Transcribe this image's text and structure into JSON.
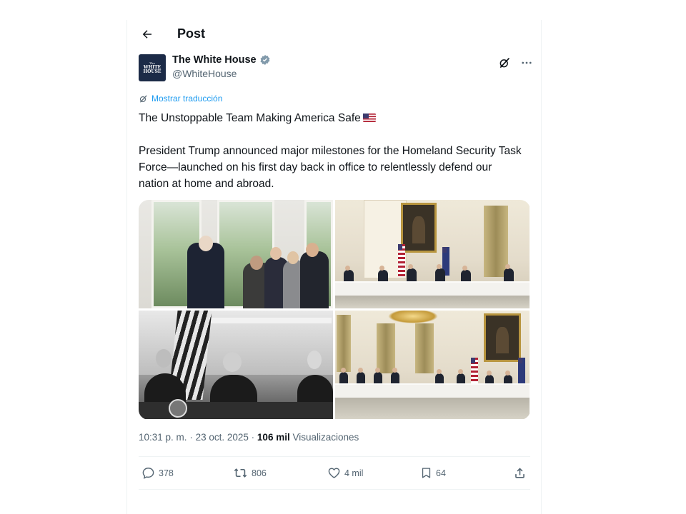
{
  "header": {
    "title": "Post"
  },
  "author": {
    "display_name": "The White House",
    "handle": "@WhiteHouse",
    "avatar_lines": [
      "The",
      "WHITE",
      "HOUSE"
    ],
    "verified_color": "#829aab"
  },
  "translate_label": "Mostrar traducción",
  "post": {
    "line1": "The Unstoppable Team Making America Safe",
    "body": "President Trump announced major milestones for the Homeland Security Task Force—launched on his first day back in office to relentlessly defend our nation at home and abroad."
  },
  "meta": {
    "time": "10:31 p. m.",
    "separator": "·",
    "date": "23 oct. 2025",
    "views_count": "106 mil",
    "views_label": "Visualizaciones"
  },
  "actions": {
    "replies": "378",
    "reposts": "806",
    "likes": "4 mil",
    "bookmarks": "64"
  },
  "colors": {
    "text": "#0f1419",
    "secondary": "#536471",
    "link": "#1d9bf0",
    "border": "#eff3f4"
  }
}
